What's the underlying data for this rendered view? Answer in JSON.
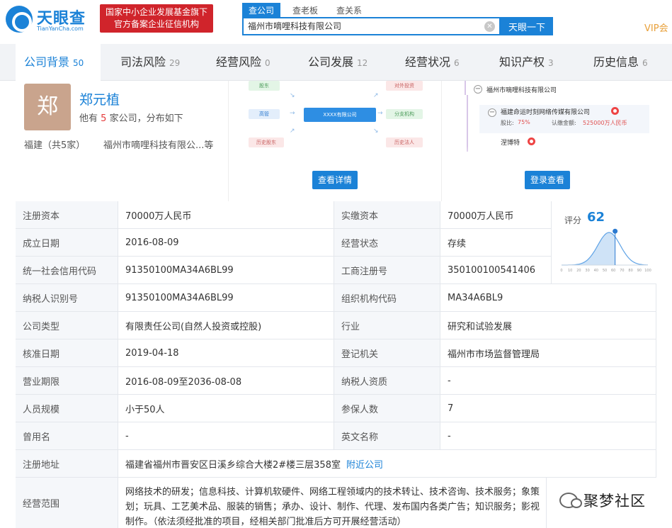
{
  "header": {
    "logo_text": "天眼查",
    "logo_sub": "TianYanCha.com",
    "banner_line1": "国家中小企业发展基金旗下",
    "banner_line2": "官方备案企业征信机构",
    "search_tabs": [
      "查公司",
      "查老板",
      "查关系"
    ],
    "search_value": "福州市嘀哩科技有限公司",
    "search_button": "天眼一下",
    "vip": "VIP会"
  },
  "nav": {
    "tabs": [
      {
        "label": "公司背景",
        "count": "50"
      },
      {
        "label": "司法风险",
        "count": "29"
      },
      {
        "label": "经营风险",
        "count": "0"
      },
      {
        "label": "公司发展",
        "count": "12"
      },
      {
        "label": "经营状况",
        "count": "6"
      },
      {
        "label": "知识产权",
        "count": "3"
      },
      {
        "label": "历史信息",
        "count": "6"
      }
    ]
  },
  "person": {
    "avatar": "郑",
    "name": "郑元植",
    "desc_prefix": "他有",
    "desc_count": "5",
    "desc_suffix": "家公司，分布如下",
    "region": "福建（共5家）",
    "company": "福州市嘀哩科技有限公...等"
  },
  "diagram": {
    "nodes": {
      "shareholder": "股东",
      "executive": "高管",
      "history_shareholder": "历史股东",
      "center": "XXXX有限公司",
      "investment": "对外投资",
      "branch": "分支机构",
      "history_legal": "历史法人"
    },
    "button": "查看详情"
  },
  "tree": {
    "root": "福州市嘀哩科技有限公司",
    "child": "福建命运时刻网络传媒有限公司",
    "ratio_label": "股比:",
    "ratio_value": "75%",
    "capital_label": "认缴金额:",
    "capital_value": "525000万人民币",
    "child2": "涅博特",
    "button": "登录查看"
  },
  "score": {
    "label": "评分",
    "value": "62",
    "marker_fraction": 0.62,
    "ticks": [
      "0",
      "10",
      "20",
      "30",
      "40",
      "50",
      "60",
      "70",
      "80",
      "90",
      "100"
    ]
  },
  "table": {
    "rows": [
      {
        "l1": "注册资本",
        "v1": "70000万人民币",
        "l2": "实缴资本",
        "v2": "70000万人民币"
      },
      {
        "l1": "成立日期",
        "v1": "2016-08-09",
        "l2": "经营状态",
        "v2": "存续"
      },
      {
        "l1": "统一社会信用代码",
        "v1": "91350100MA34A6BL99",
        "l2": "工商注册号",
        "v2": "350100100541406"
      },
      {
        "l1": "纳税人识别号",
        "v1": "91350100MA34A6BL99",
        "l2": "组织机构代码",
        "v2": "MA34A6BL9"
      },
      {
        "l1": "公司类型",
        "v1": "有限责任公司(自然人投资或控股)",
        "l2": "行业",
        "v2": "研究和试验发展"
      },
      {
        "l1": "核准日期",
        "v1": "2019-04-18",
        "l2": "登记机关",
        "v2": "福州市市场监督管理局"
      },
      {
        "l1": "营业期限",
        "v1": "2016-08-09至2036-08-08",
        "l2": "纳税人资质",
        "v2": "-"
      },
      {
        "l1": "人员规模",
        "v1": "小于50人",
        "l2": "参保人数",
        "v2": "7"
      },
      {
        "l1": "曾用名",
        "v1": "-",
        "l2": "英文名称",
        "v2": "-"
      }
    ],
    "address_label": "注册地址",
    "address_value": "福建省福州市晋安区日溪乡综合大楼2#楼三层358室",
    "address_link": "附近公司",
    "scope_label": "经营范围",
    "scope_value": "网络技术的研发；信息科技、计算机软硬件、网络工程领域内的技术转让、技术咨询、技术服务；象策划；玩具、工艺美术品、服装的销售；承办、设计、制作、代理、发布国内各类广告；知识服务；影视制作。（依法须经批准的项目，经相关部门批准后方可开展经营活动）"
  },
  "watermark": {
    "text": "聚梦社区"
  }
}
